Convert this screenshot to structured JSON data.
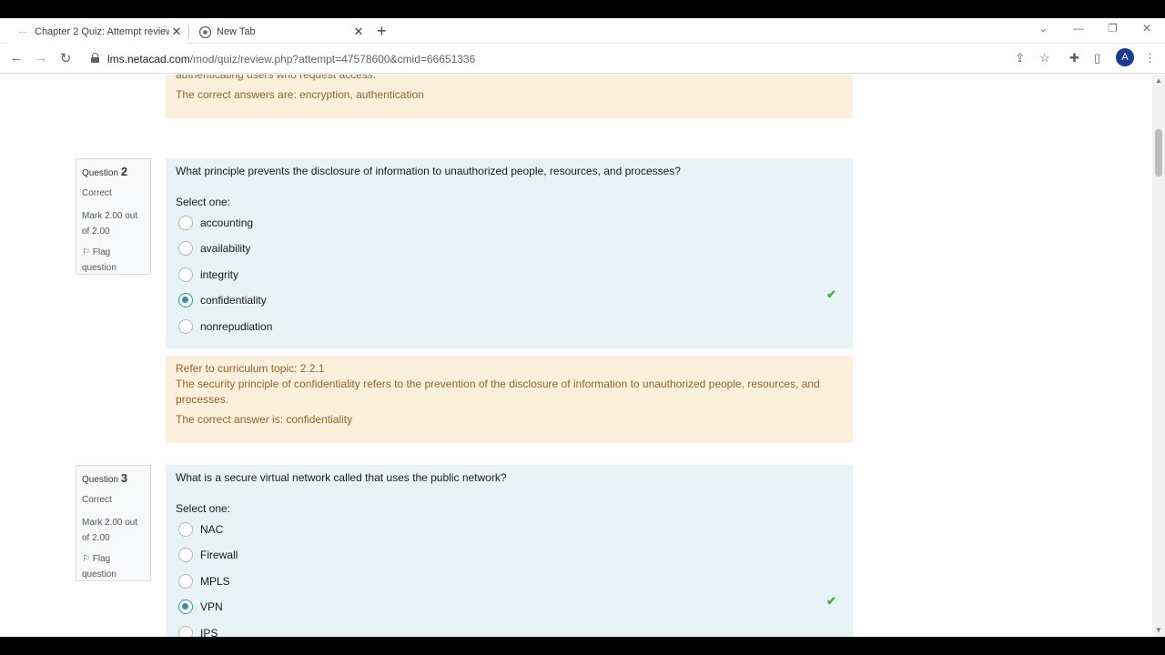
{
  "browser": {
    "tabs": [
      {
        "title": "Chapter 2 Quiz: Attempt review",
        "active": true
      },
      {
        "title": "New Tab",
        "active": false
      }
    ],
    "url_host": "lms.netacad.com",
    "url_path": "/mod/quiz/review.php?attempt=47578600&cmid=66651336",
    "profile_initial": "A"
  },
  "prev_feedback": {
    "cut_text": "authenticating users who request access.",
    "correct": "The correct answers are: encryption, authentication"
  },
  "questions": [
    {
      "label": "Question",
      "number": "2",
      "state": "Correct",
      "mark": "Mark 2.00 out of 2.00",
      "flag": "Flag question",
      "text": "What principle prevents the disclosure of information to unauthorized people, resources, and processes?",
      "select_label": "Select one:",
      "options": [
        "accounting",
        "availability",
        "integrity",
        "confidentiality",
        "nonrepudiation"
      ],
      "selected_index": 3,
      "feedback": {
        "topic": "Refer to curriculum topic: 2.2.1",
        "explanation": "The security principle of confidentiality refers to the prevention of the disclosure of information to unauthorized people, resources, and processes.",
        "correct": "The correct answer is: confidentiality"
      }
    },
    {
      "label": "Question",
      "number": "3",
      "state": "Correct",
      "mark": "Mark 2.00 out of 2.00",
      "flag": "Flag question",
      "text": "What is a secure virtual network called that uses the public network?",
      "select_label": "Select one:",
      "options": [
        "NAC",
        "Firewall",
        "MPLS",
        "VPN",
        "IPS"
      ],
      "selected_index": 3
    }
  ],
  "colors": {
    "question_bg": "#e7f3f5",
    "feedback_bg": "#fcefdc",
    "correct_check": "#4fa74a"
  }
}
